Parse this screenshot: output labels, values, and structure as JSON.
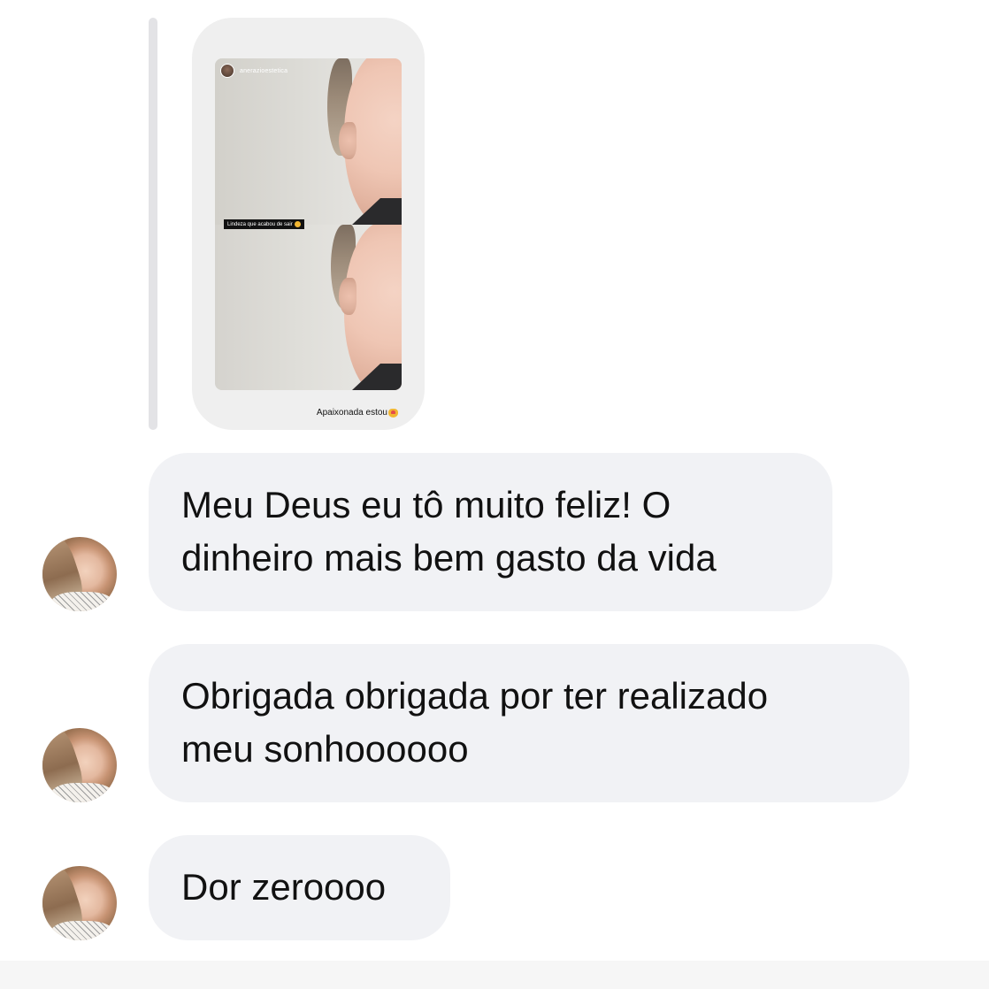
{
  "story_reply": {
    "account_name": "anerazioestetica",
    "caption": "Lindeza que acabou de sair",
    "reply_text": "Apaixonada estou",
    "reply_emoji_icon": "smiling-face-with-hearts-icon"
  },
  "messages": [
    {
      "lines": [
        "Meu Deus eu tô muito feliz! O",
        "dinheiro mais bem gasto da vida"
      ]
    },
    {
      "lines": [
        "Obrigada obrigada por ter realizado",
        "meu sonhoooooo"
      ]
    },
    {
      "lines": [
        "Dor zeroooo"
      ]
    }
  ],
  "colors": {
    "bubble_background": "#f1f2f5",
    "story_card_background": "#efefef",
    "reply_line": "#e3e3e6",
    "text": "#111111"
  }
}
